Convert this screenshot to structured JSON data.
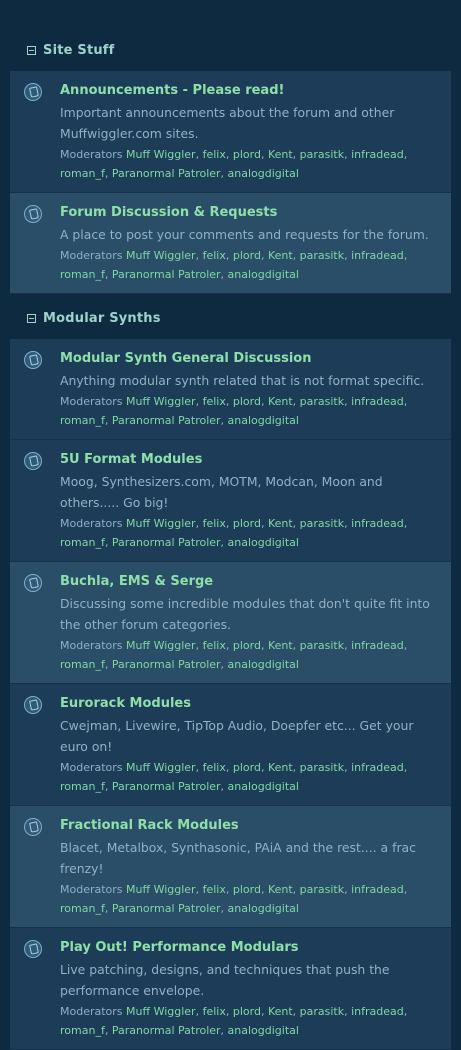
{
  "moderators_label": "Moderators",
  "moderators": [
    "Muff Wiggler",
    "felix",
    "plord",
    "Kent",
    "parasitk",
    "infradead",
    "roman_f",
    "Paranormal Patroler",
    "analogdigital"
  ],
  "categories": [
    {
      "title": "Site Stuff",
      "forums": [
        {
          "title": "Announcements - Please read!",
          "desc": "Important announcements about the forum and other Muffwiggler.com sites."
        },
        {
          "title": "Forum Discussion & Requests",
          "desc": "A place to post your comments and requests for the forum."
        }
      ]
    },
    {
      "title": "Modular Synths",
      "forums": [
        {
          "title": "Modular Synth General Discussion",
          "desc": "Anything modular synth related that is not format specific."
        },
        {
          "title": "5U Format Modules",
          "desc": "Moog, Synthesizers.com, MOTM, Modcan, Moon and others..... Go big!"
        },
        {
          "title": "Buchla, EMS & Serge",
          "desc": "Discussing some incredible modules that don't quite fit into the other forum categories."
        },
        {
          "title": "Eurorack Modules",
          "desc": "Cwejman, Livewire, TipTop Audio, Doepfer etc... Get your euro on!"
        },
        {
          "title": "Fractional Rack Modules",
          "desc": "Blacet, Metalbox, Synthasonic, PAiA and the rest.... a frac frenzy!"
        },
        {
          "title": "Play Out! Performance Modulars",
          "desc": "Live patching, designs, and techniques that push the performance envelope."
        }
      ]
    }
  ]
}
